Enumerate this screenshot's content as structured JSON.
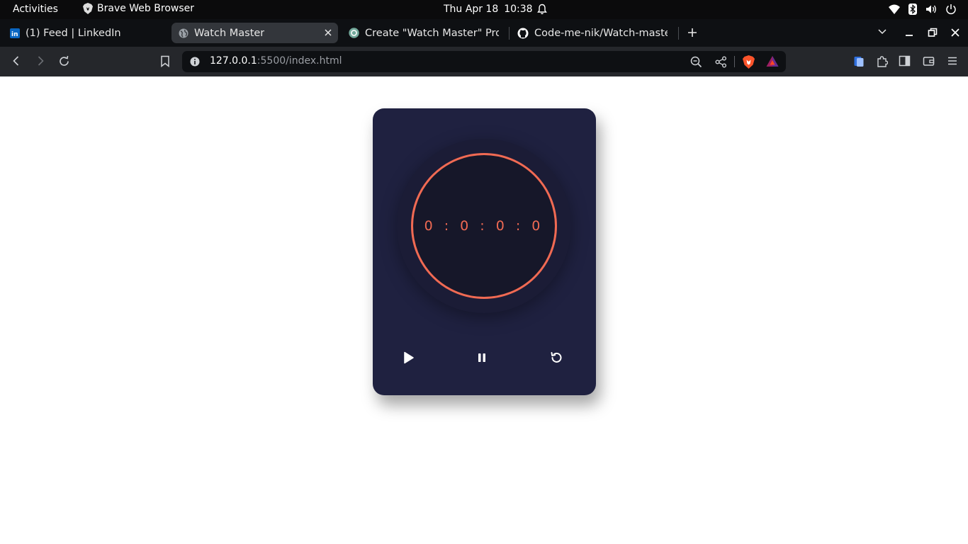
{
  "system": {
    "activities": "Activities",
    "app_name": "Brave Web Browser",
    "date": "Thu Apr 18",
    "time": "10:38"
  },
  "tabs": [
    {
      "label": "(1) Feed | LinkedIn",
      "icon": "linkedin-icon",
      "active": false
    },
    {
      "label": "Watch Master",
      "icon": "globe-icon",
      "active": true
    },
    {
      "label": "Create \"Watch Master\" Proje",
      "icon": "chatgpt-icon",
      "active": false
    },
    {
      "label": "Code-me-nik/Watch-master",
      "icon": "github-icon",
      "active": false
    }
  ],
  "address": {
    "host": "127.0.0.1",
    "path": ":5500/index.html"
  },
  "stopwatch": {
    "display": "0 : 0 : 0 : 0",
    "accent_color": "#f06a53",
    "card_color": "#1f2140",
    "controls": [
      "play-icon",
      "pause-icon",
      "reset-icon"
    ]
  }
}
